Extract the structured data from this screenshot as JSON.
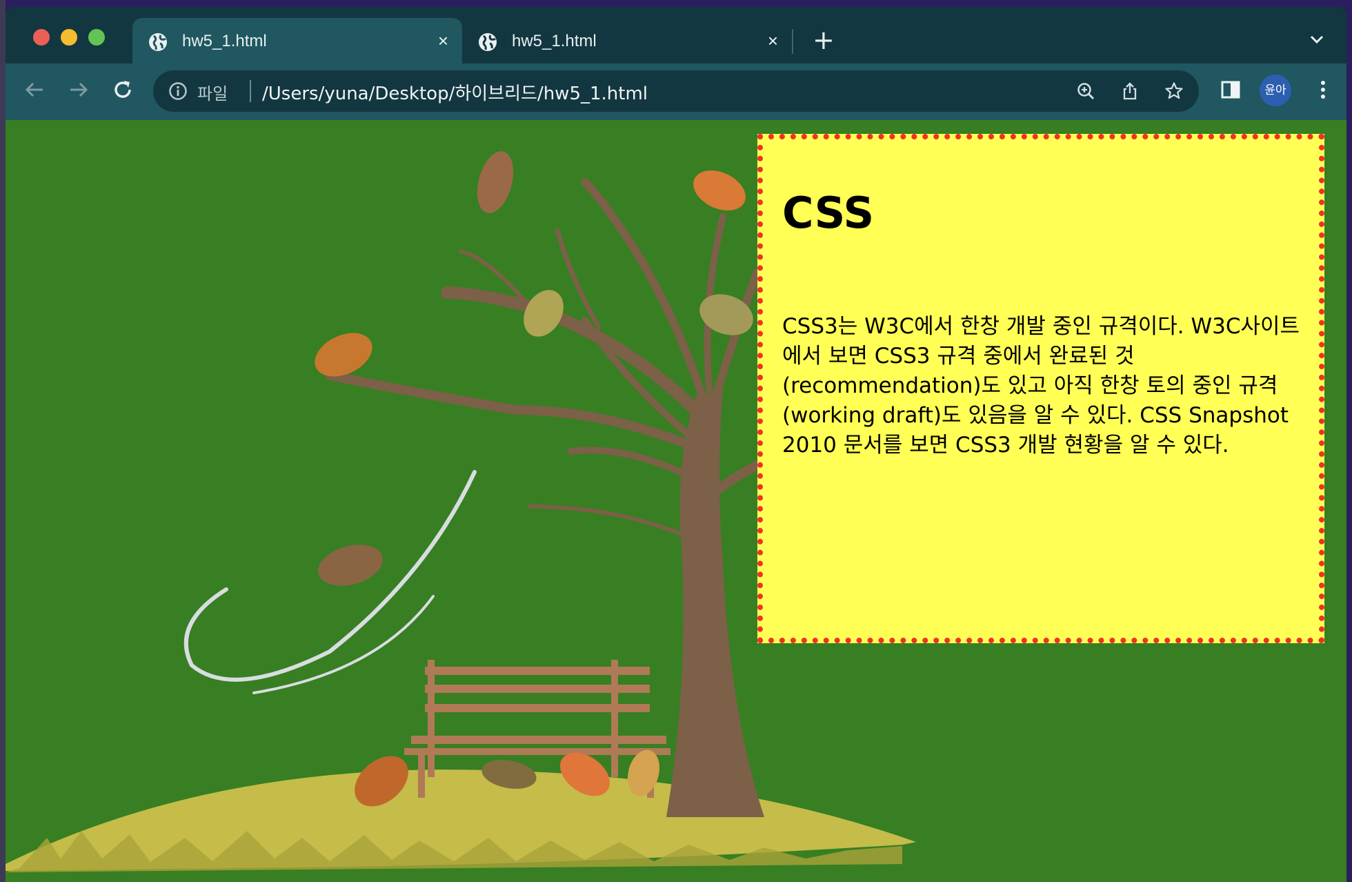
{
  "browser": {
    "tabs": [
      {
        "title": "hw5_1.html",
        "active": true
      },
      {
        "title": "hw5_1.html",
        "active": false
      }
    ],
    "tab_close_glyph": "×",
    "new_tab_glyph": "+",
    "address": {
      "scheme_label": "파일",
      "url": "/Users/yuna/Desktop/하이브리드/hw5_1.html"
    },
    "profile_label": "윤아",
    "colors": {
      "tab_strip": "#133740",
      "toolbar": "#205760",
      "page_background": "#377f22"
    }
  },
  "page": {
    "heading": "CSS",
    "body_text": "CSS3는 W3C에서 한창 개발 중인 규격이다. W3C사이트에서 보면 CSS3 규격 중에서 완료된 것 (recommendation)도 있고 아직 한창 토의 중인 규격 (working draft)도 있음을 알 수 있다. CSS Snapshot 2010 문서를 보면 CSS3 개발 현황을 알 수 있다.",
    "panel_background": "#ffff55",
    "panel_border": "#ee3322"
  }
}
